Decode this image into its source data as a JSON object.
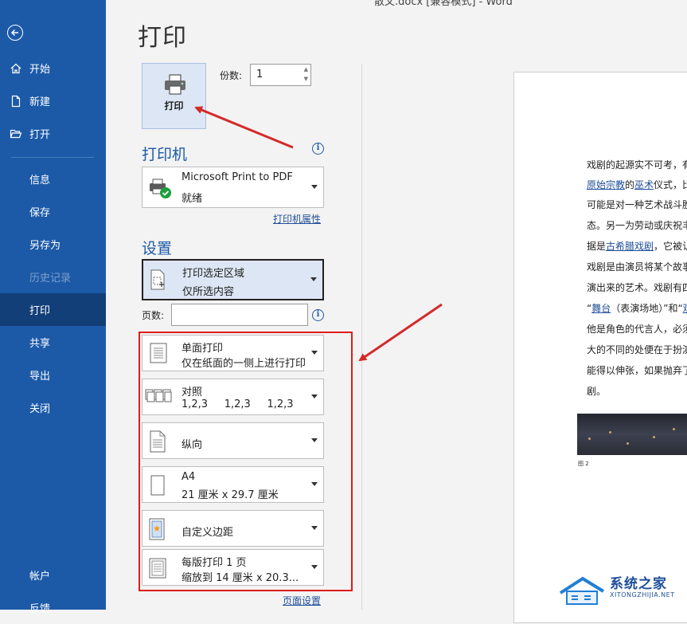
{
  "window": {
    "title": "散文.docx [兼容模式]  -  Word"
  },
  "nav": {
    "items": [
      {
        "label": "开始",
        "icon": "home-icon"
      },
      {
        "label": "新建",
        "icon": "new-document-icon"
      },
      {
        "label": "打开",
        "icon": "open-folder-icon"
      },
      {
        "label": "信息"
      },
      {
        "label": "保存"
      },
      {
        "label": "另存为"
      },
      {
        "label": "历史记录",
        "state": "disabled"
      },
      {
        "label": "打印",
        "state": "active"
      },
      {
        "label": "共享"
      },
      {
        "label": "导出"
      },
      {
        "label": "关闭"
      },
      {
        "label": "帐户"
      },
      {
        "label": "反馈"
      }
    ]
  },
  "page": {
    "title": "打印"
  },
  "print": {
    "button_label": "打印",
    "copies_label": "份数:",
    "copies_value": "1"
  },
  "printer": {
    "heading": "打印机",
    "name": "Microsoft Print to PDF",
    "status": "就绪",
    "properties_link": "打印机属性"
  },
  "settings": {
    "heading": "设置",
    "range": {
      "line1": "打印选定区域",
      "line2": "仅所选内容"
    },
    "pages_label": "页数:",
    "pages_value": "",
    "sides": {
      "line1": "单面打印",
      "line2": "仅在纸面的一侧上进行打印"
    },
    "collate": {
      "line1": "对照",
      "line2": "1,2,3     1,2,3     1,2,3"
    },
    "orientation": {
      "line1": "纵向"
    },
    "paper": {
      "line1": "A4",
      "line2": "21 厘米 x 29.7 厘米"
    },
    "margins": {
      "line1": "自定义边距"
    },
    "per_sheet": {
      "line1": "每版打印 1 页",
      "line2": "缩放到 14 厘米 x 20.3..."
    },
    "page_setup_link": "页面设置"
  },
  "preview": {
    "lines": [
      {
        "text": "戏剧的起源实不可考，有"
      },
      {
        "pre": "",
        "link": "原始宗教",
        "mid": "的",
        "link2": "巫术",
        "post": "仪式，比"
      },
      {
        "text": "可能是对一种艺术战斗胜"
      },
      {
        "text": "态。另一为劳动或庆祝丰"
      },
      {
        "pre": "据是",
        "link": "古希腊戏剧",
        "post": "，它被认"
      },
      {
        "text": "戏剧是由演员将某个故事"
      },
      {
        "text": "演出来的艺术。戏剧有四"
      },
      {
        "pre": "“",
        "link": "舞台",
        "post": "（表演场地）”和“",
        "link2": "观",
        "post2": ""
      },
      {
        "text": "他是角色的代言人，必须"
      },
      {
        "text": "大的不同的处便在于扮演"
      },
      {
        "text": "能得以伸张，如果抛弃了"
      },
      {
        "text": "剧。"
      }
    ],
    "figure_caption": "图 2"
  },
  "watermark": {
    "title": "系统之家",
    "subtitle": "XITONGZHIJIA.NET"
  },
  "colors": {
    "nav_bg": "#1c5aa8",
    "nav_active": "#133f78",
    "highlight_box": "#e01b1b",
    "arrow": "#d42a2a"
  }
}
